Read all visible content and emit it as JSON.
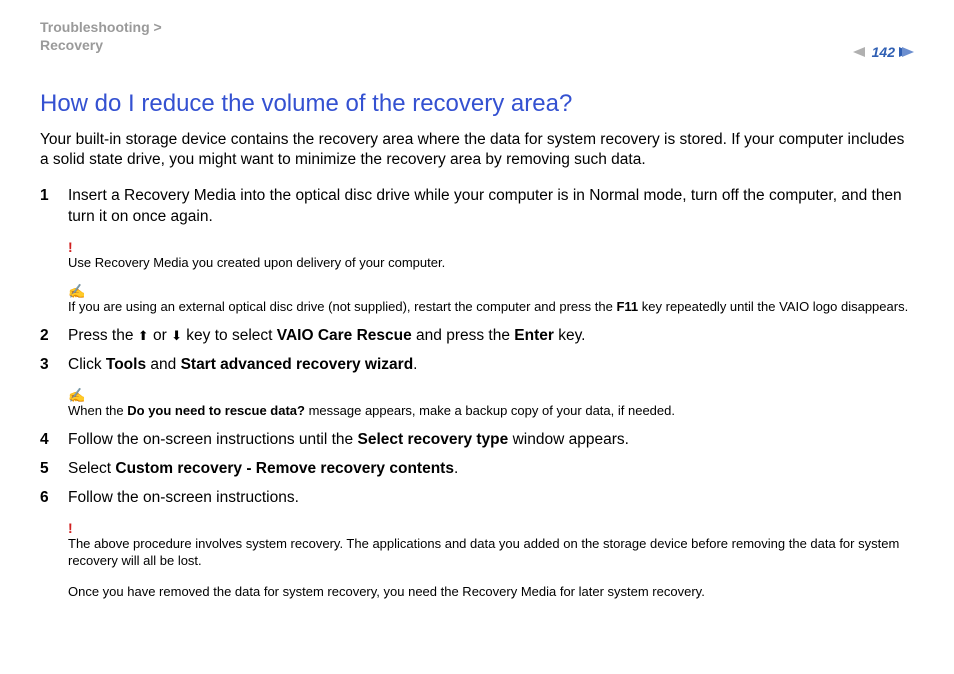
{
  "header": {
    "breadcrumb_top": "Troubleshooting >",
    "breadcrumb_sub": "Recovery",
    "page_number": "142"
  },
  "title": "How do I reduce the volume of the recovery area?",
  "intro": "Your built-in storage device contains the recovery area where the data for system recovery is stored. If your computer includes a solid state drive, you might want to minimize the recovery area by removing such data.",
  "steps": {
    "s1": {
      "num": "1",
      "text": "Insert a Recovery Media into the optical disc drive while your computer is in Normal mode, turn off the computer, and then turn it on once again."
    },
    "s2": {
      "num": "2",
      "pre": "Press the ",
      "mid": " or ",
      "post1": " key to select ",
      "b1": "VAIO Care Rescue",
      "post2": " and press the ",
      "b2": "Enter",
      "post3": " key."
    },
    "s3": {
      "num": "3",
      "pre": "Click ",
      "b1": "Tools",
      "mid": " and ",
      "b2": "Start advanced recovery wizard",
      "post": "."
    },
    "s4": {
      "num": "4",
      "pre": "Follow the on-screen instructions until the ",
      "b1": "Select recovery type",
      "post": " window appears."
    },
    "s5": {
      "num": "5",
      "pre": "Select ",
      "b1": "Custom recovery - Remove recovery contents",
      "post": "."
    },
    "s6": {
      "num": "6",
      "text": "Follow the on-screen instructions."
    }
  },
  "notes": {
    "n1": {
      "marker": "!",
      "text": "Use Recovery Media you created upon delivery of your computer."
    },
    "n2": {
      "marker": "✍",
      "pre": "If you are using an external optical disc drive (not supplied), restart the computer and press the ",
      "b1": "F11",
      "post": " key repeatedly until the VAIO logo disappears."
    },
    "n3": {
      "marker": "✍",
      "pre": "When the ",
      "b1": "Do you need to rescue data?",
      "post": " message appears, make a backup copy of your data, if needed."
    },
    "n4": {
      "marker": "!",
      "text": "The above procedure involves system recovery. The applications and data you added on the storage device before removing the data for system recovery will all be lost."
    },
    "n5": {
      "text": "Once you have removed the data for system recovery, you need the Recovery Media for later system recovery."
    }
  },
  "icons": {
    "up_arrow": "⬆",
    "down_arrow": "⬇"
  }
}
